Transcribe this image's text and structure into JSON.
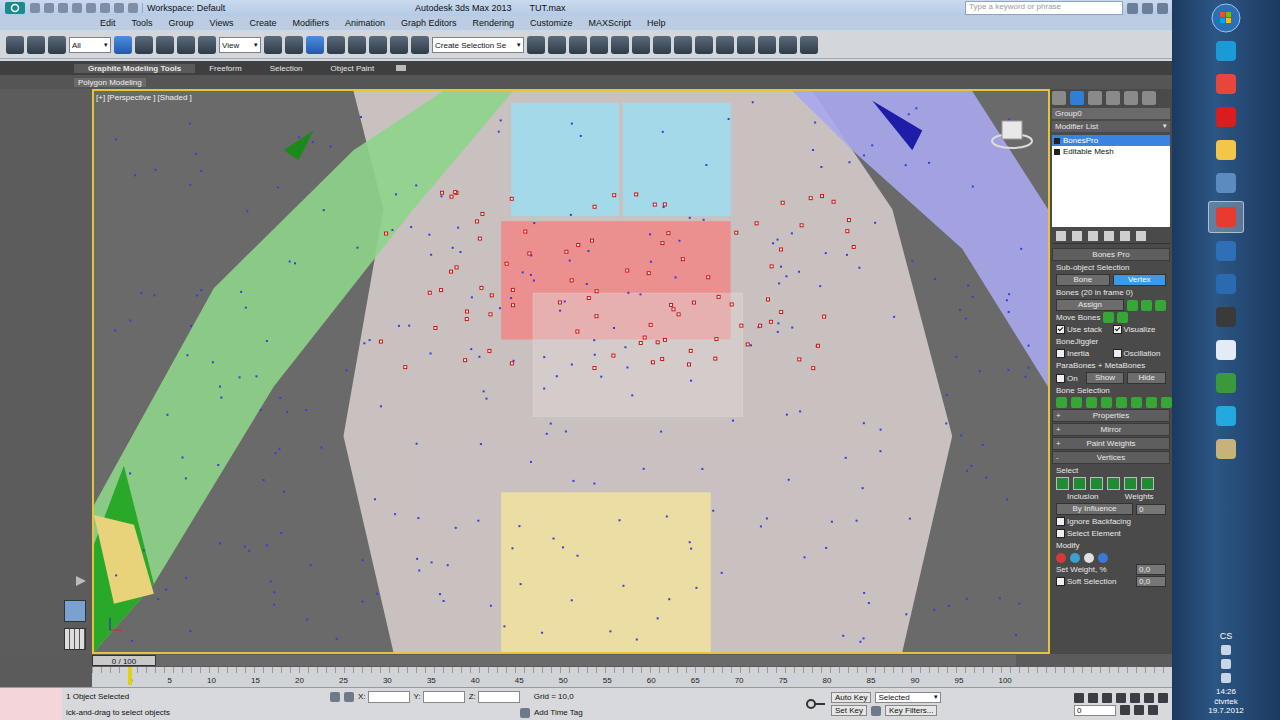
{
  "title_bar": {
    "workspace": "Workspace: Default",
    "app_title": "Autodesk 3ds Max 2013",
    "file": "TUT.max",
    "search_placeholder": "Type a keyword or phrase"
  },
  "menu": [
    "Edit",
    "Tools",
    "Group",
    "Views",
    "Create",
    "Modifiers",
    "Animation",
    "Graph Editors",
    "Rendering",
    "Customize",
    "MAXScript",
    "Help"
  ],
  "toolbar": {
    "filter": "All",
    "ref_coord": "View",
    "named_selection": "Create Selection Se"
  },
  "ribbon_tabs": [
    {
      "label": "Graphite Modeling Tools",
      "selected": true
    },
    {
      "label": "Freeform",
      "selected": false
    },
    {
      "label": "Selection",
      "selected": false
    },
    {
      "label": "Object Paint",
      "selected": false
    }
  ],
  "ribbon_panel": "Polygon Modeling",
  "viewport": {
    "labels": [
      "[+]",
      "[Perspective ]",
      "[Shaded ]"
    ]
  },
  "command_panel": {
    "object_name": "Group0",
    "modifier_list": "Modifier List",
    "stack": [
      {
        "label": "BonesPro",
        "selected": true
      },
      {
        "label": "Editable Mesh",
        "selected": false
      }
    ]
  },
  "bones_pro": {
    "title": "Bones Pro",
    "subobject_label": "Sub-object Selection",
    "subobject_buttons": [
      {
        "label": "Bone",
        "selected": false
      },
      {
        "label": "Vertex",
        "selected": true
      }
    ],
    "bones_label": "Bones (20 in frame 0)",
    "assign": "Assign",
    "move_bones": "Move Bones",
    "checkboxes": [
      {
        "label": "Use stack",
        "checked": true
      },
      {
        "label": "Visualize",
        "checked": true
      }
    ],
    "jiggler_title": "BoneJiggler",
    "jiggler": [
      {
        "label": "Inertia",
        "checked": false
      },
      {
        "label": "Oscillation",
        "checked": false
      }
    ],
    "parabones_title": "ParaBones + MetaBones",
    "parabones_on": {
      "label": "On",
      "checked": false
    },
    "parabones_buttons": [
      "Show",
      "Hide"
    ],
    "bone_selection": "Bone Selection"
  },
  "collapsed_rollouts": [
    {
      "sign": "+",
      "label": "Properties"
    },
    {
      "sign": "+",
      "label": "Mirror"
    },
    {
      "sign": "+",
      "label": "Paint Weights"
    }
  ],
  "vertices": {
    "sign": "-",
    "title": "Vertices",
    "select_label": "Select",
    "select_modes": [
      "Inclusion",
      "Weights"
    ],
    "by_influence": "By Influence",
    "by_influence_value": "0",
    "checks": [
      {
        "label": "Ignore Backfacing",
        "checked": false
      },
      {
        "label": "Select Element",
        "checked": false
      }
    ],
    "modify_label": "Modify",
    "set_weight": "Set Weight, %",
    "set_weight_value": "0,0",
    "soft_selection": {
      "label": "Soft Selection",
      "checked": false
    },
    "soft_value": "0,0"
  },
  "timeline": {
    "position": "0 / 100",
    "level": 0,
    "ticks": [
      "0",
      "5",
      "10",
      "15",
      "20",
      "25",
      "30",
      "35",
      "40",
      "45",
      "50",
      "55",
      "60",
      "65",
      "70",
      "75",
      "80",
      "85",
      "90",
      "95",
      "100"
    ]
  },
  "status_bar": {
    "selection": "1 Object Selected",
    "prompt": "ick-and-drag to select objects",
    "coords": [
      "X:",
      "Y:",
      "Z:"
    ],
    "grid": "Grid = 10,0",
    "add_time_tag": "Add Time Tag",
    "auto_key": "Auto Key",
    "key_mode": "Selected",
    "set_key": "Set Key",
    "key_filters": "Key Filters...",
    "frame": "0"
  },
  "taskbar": {
    "language": "CS",
    "time": "14:26",
    "day": "čtvrtek",
    "date": "19.7.2012"
  }
}
